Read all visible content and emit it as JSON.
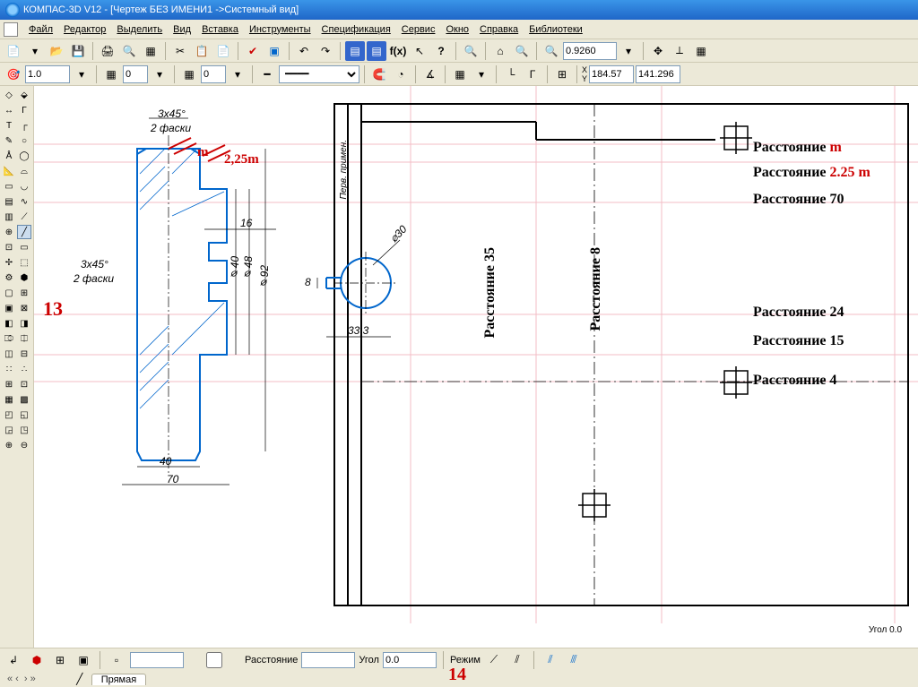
{
  "title": "КОМПАС-3D V12 - [Чертеж БЕЗ ИМЕНИ1 ->Системный вид]",
  "menu": {
    "file": "Файл",
    "edit": "Редактор",
    "select": "Выделить",
    "view": "Вид",
    "insert": "Вставка",
    "tools": "Инструменты",
    "spec": "Спецификация",
    "service": "Сервис",
    "window": "Окно",
    "help": "Справка",
    "libs": "Библиотеки"
  },
  "toolbars": {
    "zoom_combo": "0.9260",
    "scale_combo": "1.0",
    "zero": "0",
    "zero2": "0",
    "coord_x": "184.57",
    "coord_y": "141.296"
  },
  "props": {
    "distance_label": "Расстояние",
    "angle_label": "Угол",
    "angle_value": "0.0",
    "mode_label": "Режим"
  },
  "tab": {
    "name1": "Прямая"
  },
  "drawing": {
    "chamfer_top": "3x45°",
    "chamfer_top2": "2 фаски",
    "chamfer_left": "3x45°",
    "chamfer_left2": "2 фаски",
    "dim16": "16",
    "dim40": "40",
    "dim70": "70",
    "dim_d40": "⌀40",
    "dim_d48": "⌀48",
    "dim_d92": "⌀92",
    "dim_d30": "⌀30",
    "dim8": "8",
    "dim33": "33,3",
    "perv": "Перв. примен.",
    "col1": "Расстояние 35",
    "col2": "Расстояние 8",
    "corner": "Угол 0.0"
  },
  "overlays": {
    "m": "m",
    "m225": "2,25m",
    "thirteen": "13",
    "fourteen": "14"
  },
  "distances": {
    "d1a": "Расстояние  ",
    "d1b": "m",
    "d2a": "Расстояние ",
    "d2b": "2.25 m",
    "d3": "Расстояние  70",
    "d4": "Расстояние 24",
    "d5": "Расстояние 15",
    "d6": "Расстояние 4"
  }
}
